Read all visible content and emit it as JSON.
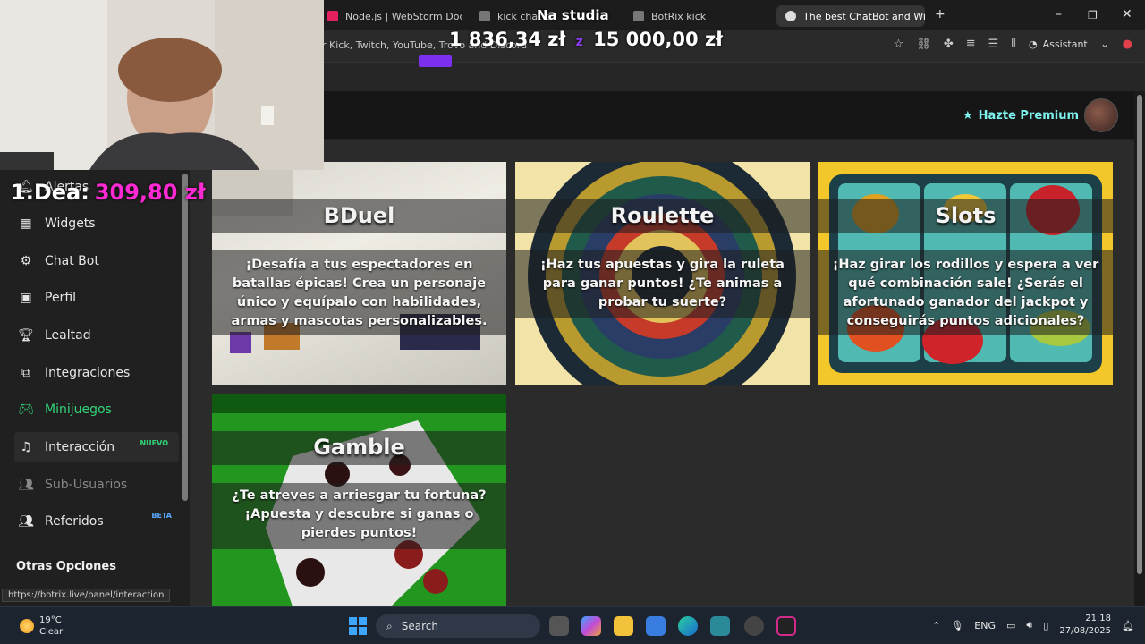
{
  "browser": {
    "tabs": [
      {
        "label": "Node.js | WebStorm Docume",
        "active": false
      },
      {
        "label": "kick chat bo",
        "active": false
      },
      {
        "label": "BotRix kick",
        "active": false
      },
      {
        "label": "The best ChatBot and Widget",
        "active": true
      }
    ],
    "url_fragment": "r Kick, Twitch, YouTube, Trovo and Discord",
    "assistant_label": "Assistant"
  },
  "header": {
    "premium_label": "Hazte Premium"
  },
  "sidebar": {
    "items": [
      {
        "label": "Alertas",
        "icon": "bell-icon"
      },
      {
        "label": "Widgets",
        "icon": "grid-icon"
      },
      {
        "label": "Chat Bot",
        "icon": "robot-icon"
      },
      {
        "label": "Perfil",
        "icon": "id-card-icon"
      },
      {
        "label": "Lealtad",
        "icon": "trophy-icon"
      },
      {
        "label": "Integraciones",
        "icon": "plug-icon"
      },
      {
        "label": "Minijuegos",
        "icon": "gamepad-icon",
        "active": true
      },
      {
        "label": "Interacción",
        "icon": "music-icon",
        "badge": "NUEVO"
      },
      {
        "label": "Sub-Usuarios",
        "icon": "users-icon",
        "muted": true
      },
      {
        "label": "Referidos",
        "icon": "referrals-icon",
        "badge": "BETA"
      }
    ],
    "section_title": "Otras Opciones"
  },
  "games": [
    {
      "title": "BDuel",
      "description": "¡Desafía a tus espectadores en batallas épicas! Crea un personaje único y equípalo con habilidades, armas y mascotas personalizables."
    },
    {
      "title": "Roulette",
      "description": "¡Haz tus apuestas y gira la ruleta para ganar puntos! ¿Te animas a probar tu suerte?"
    },
    {
      "title": "Slots",
      "description": "¡Haz girar los rodillos y espera a ver qué combinación sale! ¿Serás el afortunado ganador del jackpot y conseguirás puntos adicionales?"
    },
    {
      "title": "Gamble",
      "description": "¿Te atreves a arriesgar tu fortuna? ¡Apuesta y descubre si ganas o pierdes puntos!"
    }
  ],
  "status_url": "https://botrix.live/panel/interaction",
  "stream_overlay": {
    "goal_title": "Na studia",
    "goal_current": "1 836,34 zł",
    "goal_separator": "z",
    "goal_target": "15 000,00 zł",
    "goal_progress_fraction": 0.122,
    "top_donor_label": "1.Dea:",
    "top_donor_amount": "309,80 zł"
  },
  "taskbar": {
    "weather_temp": "19°C",
    "weather_desc": "Clear",
    "search_label": "Search",
    "language": "ENG",
    "time": "21:18",
    "date": "27/08/2025"
  },
  "colors": {
    "accent_green": "#31d478",
    "premium_cyan": "#7ef3ee",
    "donor_pink": "#ff2ad4",
    "goal_purple": "#7d2ff0"
  }
}
